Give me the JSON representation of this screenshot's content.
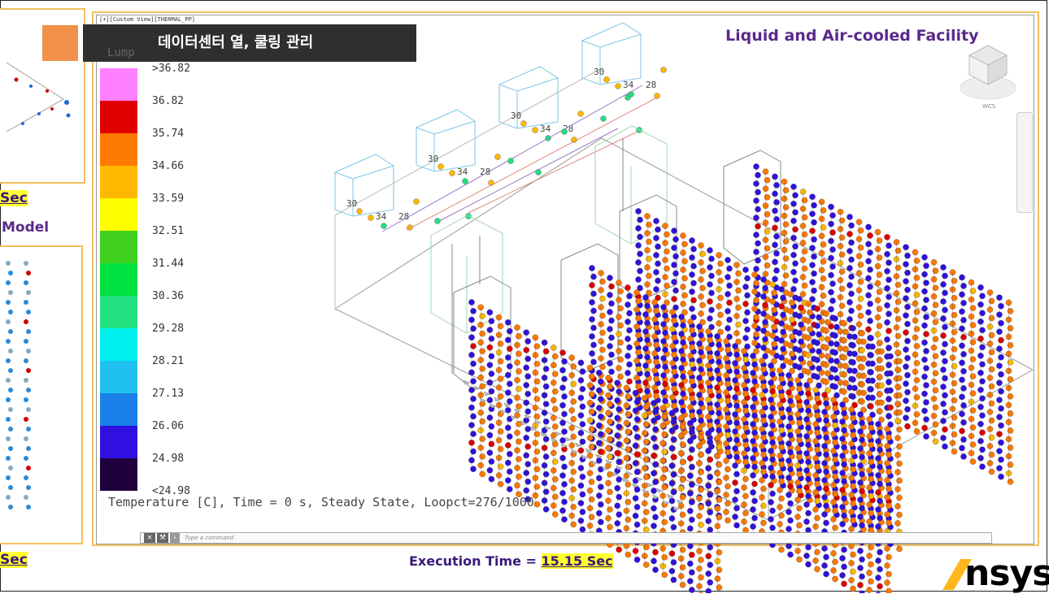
{
  "banner": {
    "title": "데이터센터 열, 쿨링 관리"
  },
  "viewport": {
    "tag": "[+][Custom View][THERMAL_PP]"
  },
  "scene": {
    "title": "Liquid and Air-cooled Facility"
  },
  "legend": {
    "header": "Lump",
    "items": [
      {
        "label": ">36.82",
        "color": "#ff80ff"
      },
      {
        "label": "36.82",
        "color": "#e00000"
      },
      {
        "label": "35.74",
        "color": "#ff7a00"
      },
      {
        "label": "34.66",
        "color": "#ffb800"
      },
      {
        "label": "33.59",
        "color": "#ffff00"
      },
      {
        "label": "32.51",
        "color": "#40d020"
      },
      {
        "label": "31.44",
        "color": "#00e040"
      },
      {
        "label": "30.36",
        "color": "#20e080"
      },
      {
        "label": "29.28",
        "color": "#00f0f0"
      },
      {
        "label": "28.21",
        "color": "#20c0f0"
      },
      {
        "label": "27.13",
        "color": "#1a80e8"
      },
      {
        "label": "26.06",
        "color": "#3010e0"
      },
      {
        "label": "24.98",
        "color": "#20003c"
      }
    ],
    "bottom_label": "<24.98"
  },
  "status": {
    "text": "Temperature [C], Time = 0 s, Steady State, Loopct=276/1000"
  },
  "command": {
    "placeholder": "Type a command",
    "close_label": "×",
    "wrench_label": "⚒"
  },
  "execution": {
    "label": "Execution Time = ",
    "value": "15.15 Sec"
  },
  "left": {
    "sec_top": "Sec",
    "model": "Model",
    "sec_bottom": "Sec"
  },
  "viewcube": {
    "wcs": "WCS"
  },
  "pipe_labels": [
    "30",
    "34",
    "28"
  ],
  "logo": {
    "text": "nsys"
  },
  "colors": {
    "accent": "#f2914a",
    "purple": "#5a2a8a",
    "highlight": "#ffff30"
  }
}
